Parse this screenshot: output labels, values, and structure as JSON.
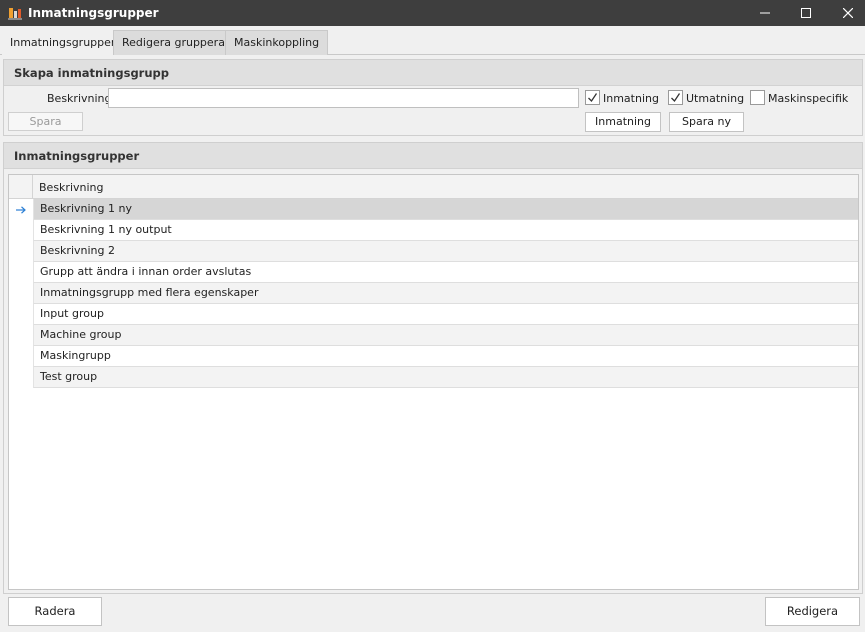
{
  "window": {
    "title": "Inmatningsgrupper",
    "app_icon": "app-logo-icon",
    "controls": [
      "minimize-icon",
      "maximize-icon",
      "close-icon"
    ]
  },
  "tabs": [
    {
      "label": "Inmatningsgrupper",
      "active": true
    },
    {
      "label": "Redigera gruppera",
      "active": false
    },
    {
      "label": "Maskinkoppling",
      "active": false
    }
  ],
  "create_panel": {
    "header": "Skapa inmatningsgrupp",
    "description_label": "Beskrivning",
    "description_value": "",
    "checkboxes": [
      {
        "label": "Inmatning",
        "checked": true
      },
      {
        "label": "Utmatning",
        "checked": true
      },
      {
        "label": "Maskinspecifik",
        "checked": false
      }
    ],
    "save_button": "Spara",
    "input_button": "Inmatning",
    "save_new_button": "Spara ny"
  },
  "list_panel": {
    "header": "Inmatningsgrupper",
    "column_header": "Beskrivning",
    "selected_indicator_icon": "arrow-right-icon",
    "rows": [
      "Beskrivning 1 ny",
      "Beskrivning 1 ny output",
      "Beskrivning 2",
      "Grupp att ändra i innan order avslutas",
      "Inmatningsgrupp med flera egenskaper",
      "Input group",
      "Machine group",
      "Maskingrupp",
      "Test group"
    ]
  },
  "footer": {
    "delete_button": "Radera",
    "edit_button": "Redigera"
  },
  "colors": {
    "titlebar": "#3e3e3e",
    "selected_row": "#d6d6d6",
    "indicator_arrow": "#2a7fd4"
  }
}
